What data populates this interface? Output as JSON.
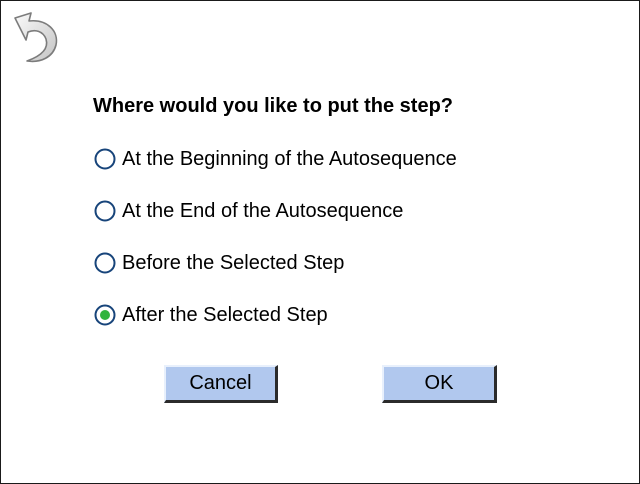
{
  "dialog": {
    "question": "Where would you like to put the step?",
    "back_icon": "back-arrow-icon",
    "options": [
      {
        "label": "At the Beginning of the Autosequence",
        "selected": false
      },
      {
        "label": "At the End of the Autosequence",
        "selected": false
      },
      {
        "label": "Before the Selected Step",
        "selected": false
      },
      {
        "label": "After the Selected Step",
        "selected": true
      }
    ],
    "buttons": {
      "cancel_label": "Cancel",
      "ok_label": "OK"
    }
  },
  "colors": {
    "button_bg": "#b1c8ee",
    "radio_ring": "#17447a",
    "radio_dot": "#2fb43c"
  }
}
